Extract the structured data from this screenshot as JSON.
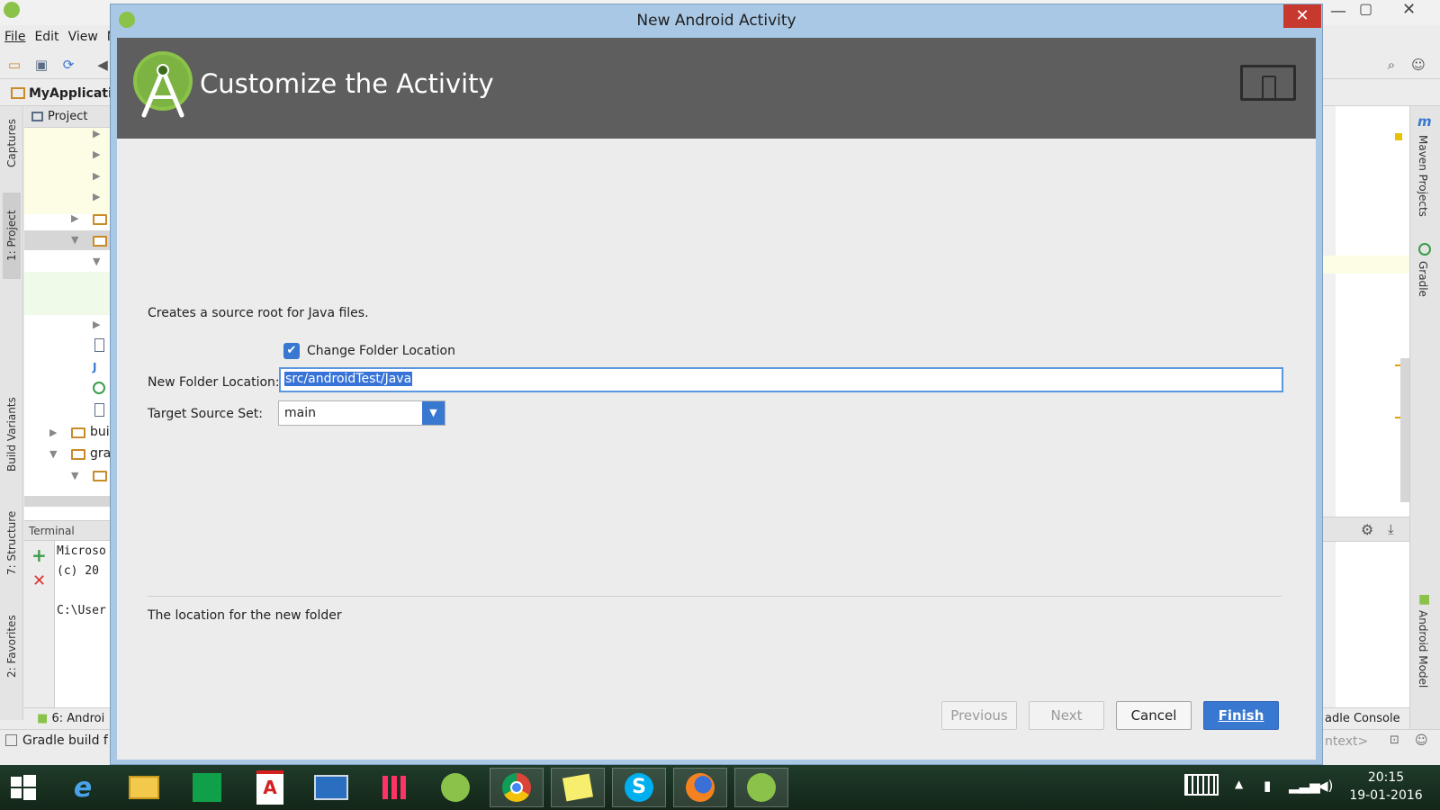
{
  "ide": {
    "menu": [
      "File",
      "Edit",
      "View",
      "N"
    ],
    "project_name": "MyApplicati",
    "project_tab": "Project",
    "left_tabs": [
      "Captures",
      "1: Project",
      "Build Variants",
      "7: Structure",
      "2: Favorites"
    ],
    "right_tabs": [
      "Maven Projects",
      "Gradle",
      "Android Model"
    ],
    "tree_items": [
      "bui",
      "gra"
    ],
    "terminal_title": "Terminal",
    "terminal_lines": [
      "Microso",
      "(c) 20",
      "C:\\User"
    ],
    "bottom_tab": "6: Androi",
    "status_text": "Gradle build f",
    "right_bottom_tab": "adle Console",
    "right_status": "ntext>"
  },
  "dialog": {
    "title": "New Android Activity",
    "header_title": "Customize the Activity",
    "description": "Creates a source root for Java files.",
    "change_folder_label": "Change Folder Location",
    "change_folder_checked": true,
    "folder_location_label": "New Folder Location:",
    "folder_location_value": "src/androidTest/Java",
    "target_source_label": "Target Source Set:",
    "target_source_value": "main",
    "help_text": "The location for the new folder",
    "buttons": {
      "previous": "Previous",
      "next": "Next",
      "cancel": "Cancel",
      "finish": "Finish"
    }
  },
  "taskbar": {
    "time": "20:15",
    "date": "19-01-2016"
  },
  "colors": {
    "accent": "#3978d1",
    "header_bg": "#5e5e5e",
    "android_green": "#8bc34a"
  }
}
